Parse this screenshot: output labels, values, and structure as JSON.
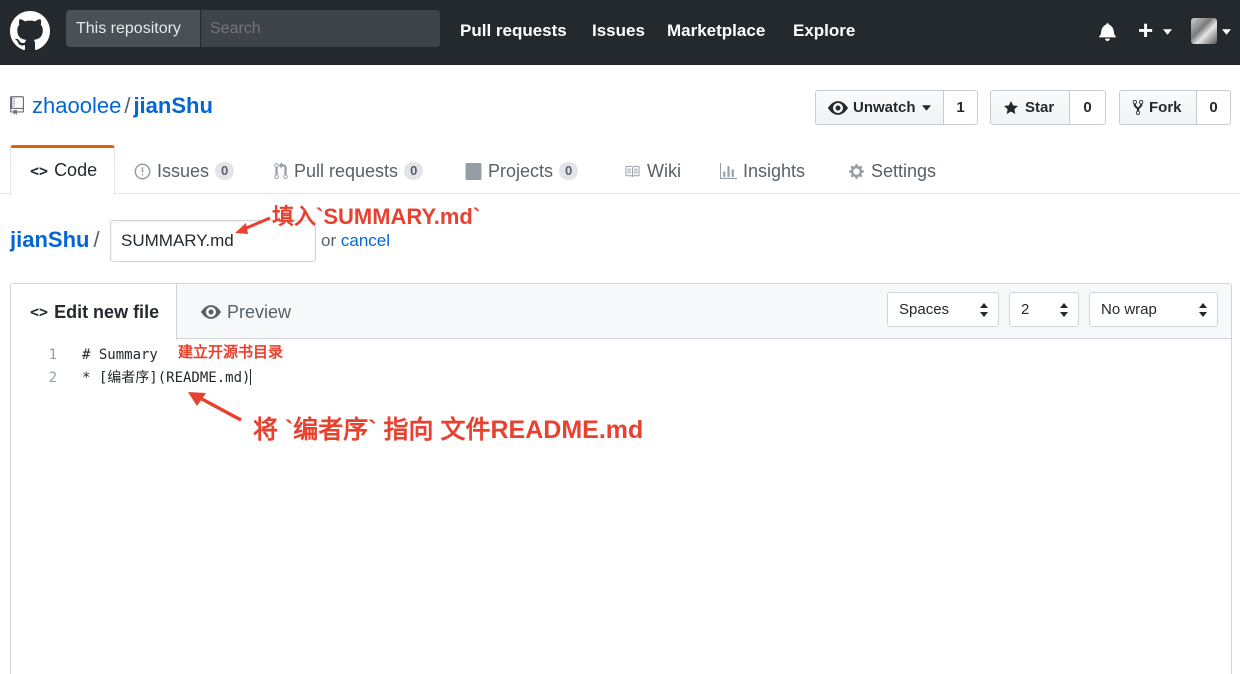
{
  "header": {
    "scope_label": "This repository",
    "search_placeholder": "Search",
    "nav": [
      "Pull requests",
      "Issues",
      "Marketplace",
      "Explore"
    ],
    "plus_label": "+"
  },
  "repo": {
    "owner": "zhaoolee",
    "separator": "/",
    "name": "jianShu",
    "watch_label": "Unwatch",
    "watch_count": "1",
    "star_label": "Star",
    "star_count": "0",
    "fork_label": "Fork",
    "fork_count": "0"
  },
  "tabs": [
    {
      "label": "Code",
      "icon": "code-icon"
    },
    {
      "label": "Issues",
      "count": "0",
      "icon": "issue-icon"
    },
    {
      "label": "Pull requests",
      "count": "0",
      "icon": "pull-request-icon"
    },
    {
      "label": "Projects",
      "count": "0",
      "icon": "project-icon"
    },
    {
      "label": "Wiki",
      "icon": "book-icon"
    },
    {
      "label": "Insights",
      "icon": "graph-icon"
    },
    {
      "label": "Settings",
      "icon": "gear-icon"
    }
  ],
  "editor": {
    "breadcrumb_repo": "jianShu",
    "breadcrumb_sep": "/",
    "filename": "SUMMARY.md",
    "or_text": "or",
    "cancel_label": "cancel",
    "edit_tab": "Edit new file",
    "preview_tab": "Preview",
    "indent_mode": "Spaces",
    "indent_size": "2",
    "wrap_mode": "No wrap",
    "lines": [
      {
        "num": "1",
        "text": "# Summary"
      },
      {
        "num": "2",
        "text": "* [编者序](README.md)"
      }
    ]
  },
  "annotations": {
    "filename_note": "填入`SUMMARY.md`",
    "toc_note": "建立开源书目录",
    "link_note": "将 `编者序` 指向 文件README.md"
  },
  "colors": {
    "header_bg": "#24292e",
    "link": "#0366d6",
    "tab_accent": "#e36209",
    "annotation": "#e8412f"
  }
}
